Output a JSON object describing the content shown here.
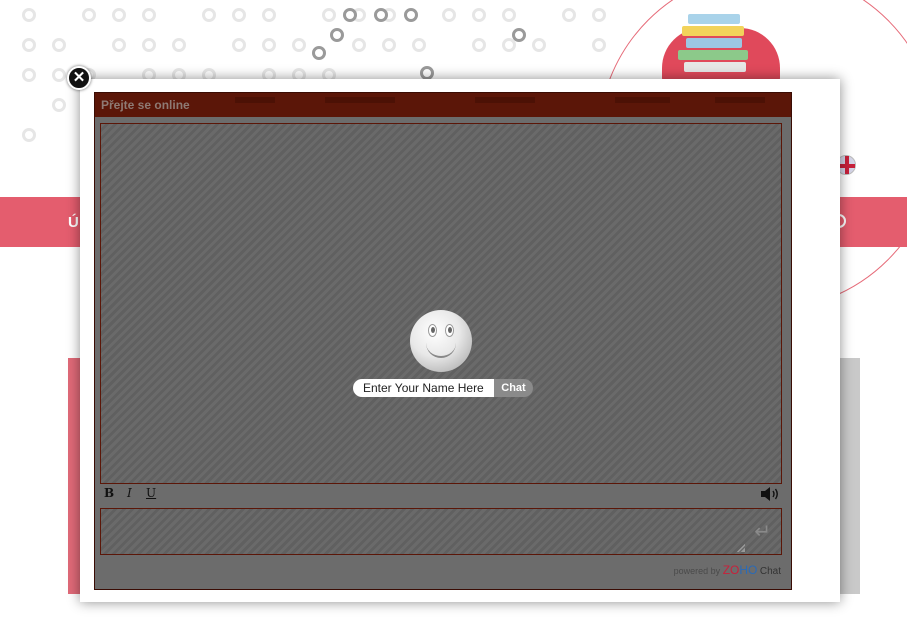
{
  "chat": {
    "header_title": "Přejte se online",
    "name_placeholder": "Enter Your Name Here",
    "chat_button": "Chat",
    "format": {
      "bold": "B",
      "italic": "I",
      "underline": "U"
    },
    "powered_by": "powered by",
    "brand_z": "ZO",
    "brand_h": "HO",
    "brand_chat": "Chat"
  },
  "background": {
    "nav_letter": "Ú"
  },
  "colors": {
    "header_bg": "#5b1608",
    "panel_bg": "#6c6c6c",
    "nav_band": "#e45d6e"
  },
  "icons": [
    "close-icon",
    "smiley-icon",
    "speaker-icon",
    "enter-icon",
    "uk-flag-icon",
    "books-icon"
  ]
}
